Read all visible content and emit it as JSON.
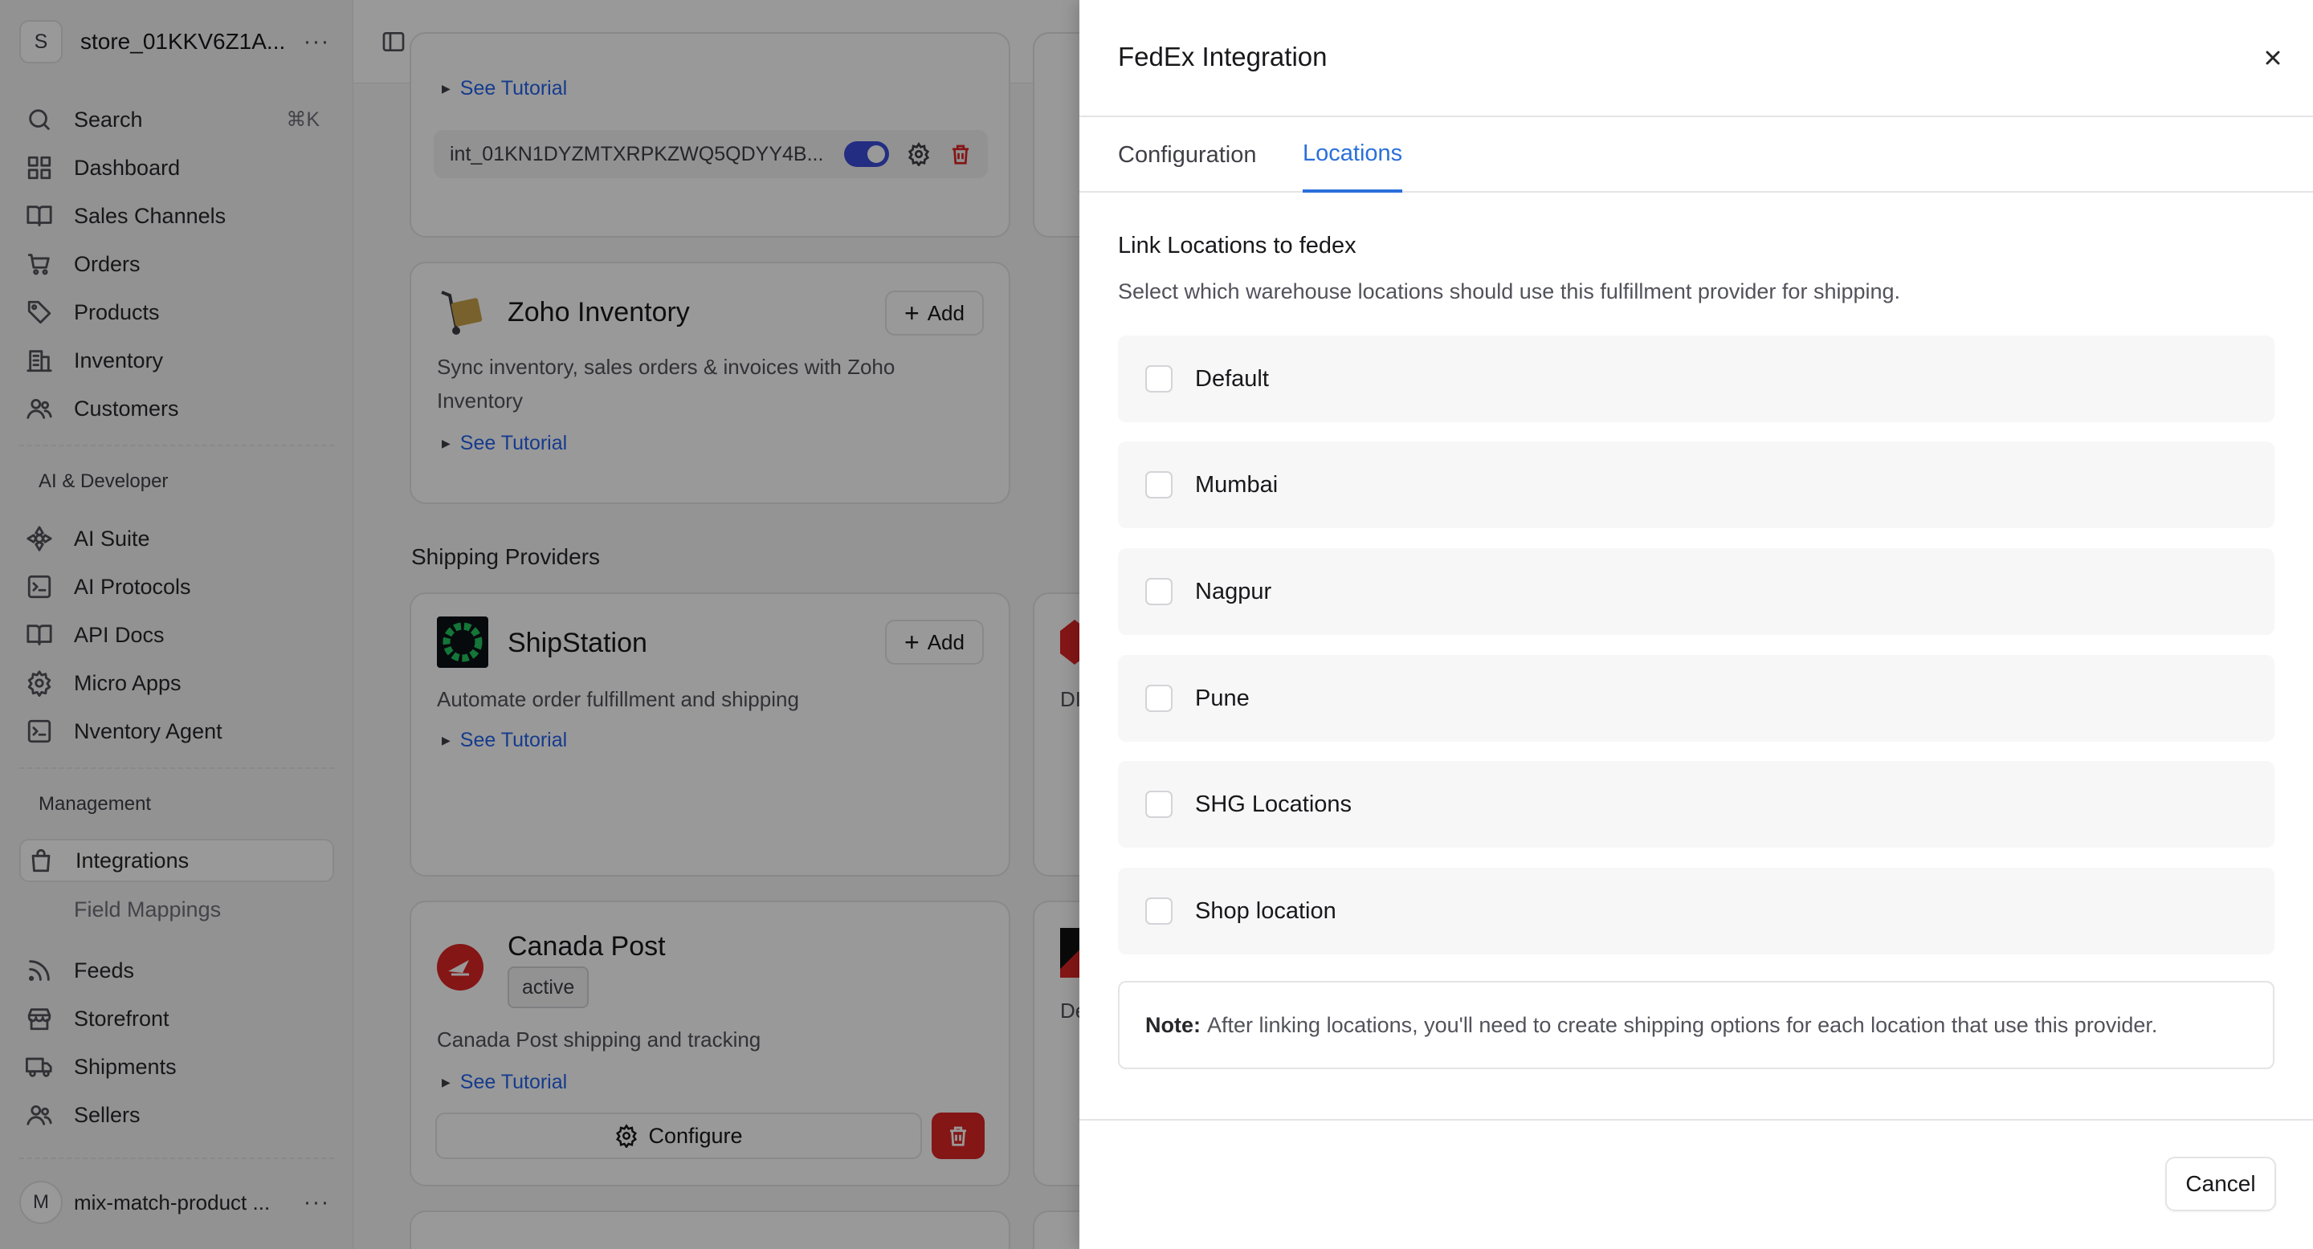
{
  "sidebar": {
    "store": {
      "initial": "S",
      "name": "store_01KKV6Z1A..."
    },
    "search": {
      "label": "Search",
      "shortcut": "⌘K"
    },
    "items": [
      {
        "label": "Dashboard",
        "icon": "dashboard-icon"
      },
      {
        "label": "Sales Channels",
        "icon": "book-icon"
      },
      {
        "label": "Orders",
        "icon": "cart-icon"
      },
      {
        "label": "Products",
        "icon": "tag-icon"
      },
      {
        "label": "Inventory",
        "icon": "building-icon"
      },
      {
        "label": "Customers",
        "icon": "users-icon"
      }
    ],
    "ai_section": "AI & Developer",
    "ai_items": [
      {
        "label": "AI Suite",
        "icon": "sparkle-icon"
      },
      {
        "label": "AI Protocols",
        "icon": "terminal-icon"
      },
      {
        "label": "API Docs",
        "icon": "book-icon"
      },
      {
        "label": "Micro Apps",
        "icon": "gear-icon"
      },
      {
        "label": "Nventory Agent",
        "icon": "terminal-icon"
      }
    ],
    "management_section": "Management",
    "management_items": [
      {
        "label": "Integrations",
        "icon": "bag-icon",
        "active": true
      },
      {
        "label": "Field Mappings",
        "sub": true
      },
      {
        "label": "Feeds",
        "icon": "rss-icon"
      },
      {
        "label": "Storefront",
        "icon": "store-icon"
      },
      {
        "label": "Shipments",
        "icon": "truck-icon"
      },
      {
        "label": "Sellers",
        "icon": "users-icon"
      }
    ],
    "user": {
      "initial": "M",
      "name": "mix-match-product ..."
    }
  },
  "main": {
    "top_card": {
      "tutorial": "See Tutorial",
      "integration_id": "int_01KN1DYZMTXRPKZWQ5QDYY4B..."
    },
    "zoho": {
      "title": "Zoho Inventory",
      "add_label": "Add",
      "description": "Sync inventory, sales orders & invoices with Zoho Inventory",
      "tutorial": "See Tutorial"
    },
    "shipping_title": "Shipping Providers",
    "shipstation": {
      "title": "ShipStation",
      "add_label": "Add",
      "description": "Automate order fulfillment and shipping",
      "tutorial": "See Tutorial"
    },
    "canada_post": {
      "title": "Canada Post",
      "badge": "active",
      "description": "Canada Post shipping and tracking",
      "tutorial": "See Tutorial",
      "configure_label": "Configure"
    },
    "right_card_fragments": {
      "frag1": "DI",
      "frag2": "De"
    }
  },
  "dialog": {
    "title": "FedEx Integration",
    "tabs": [
      {
        "label": "Configuration"
      },
      {
        "label": "Locations",
        "active": true
      }
    ],
    "heading": "Link Locations to fedex",
    "subheading": "Select which warehouse locations should use this fulfillment provider for shipping.",
    "locations": [
      {
        "label": "Default",
        "checked": false
      },
      {
        "label": "Mumbai",
        "checked": false
      },
      {
        "label": "Nagpur",
        "checked": false
      },
      {
        "label": "Pune",
        "checked": false
      },
      {
        "label": "SHG Locations",
        "checked": false
      },
      {
        "label": "Shop location",
        "checked": false
      }
    ],
    "note_label": "Note:",
    "note_text": "After linking locations, you'll need to create shipping options for each location that use this provider.",
    "cancel_label": "Cancel"
  },
  "colors": {
    "accent": "#2a6fdb",
    "danger": "#dc2626",
    "toggle_on": "#3b4bd8"
  }
}
